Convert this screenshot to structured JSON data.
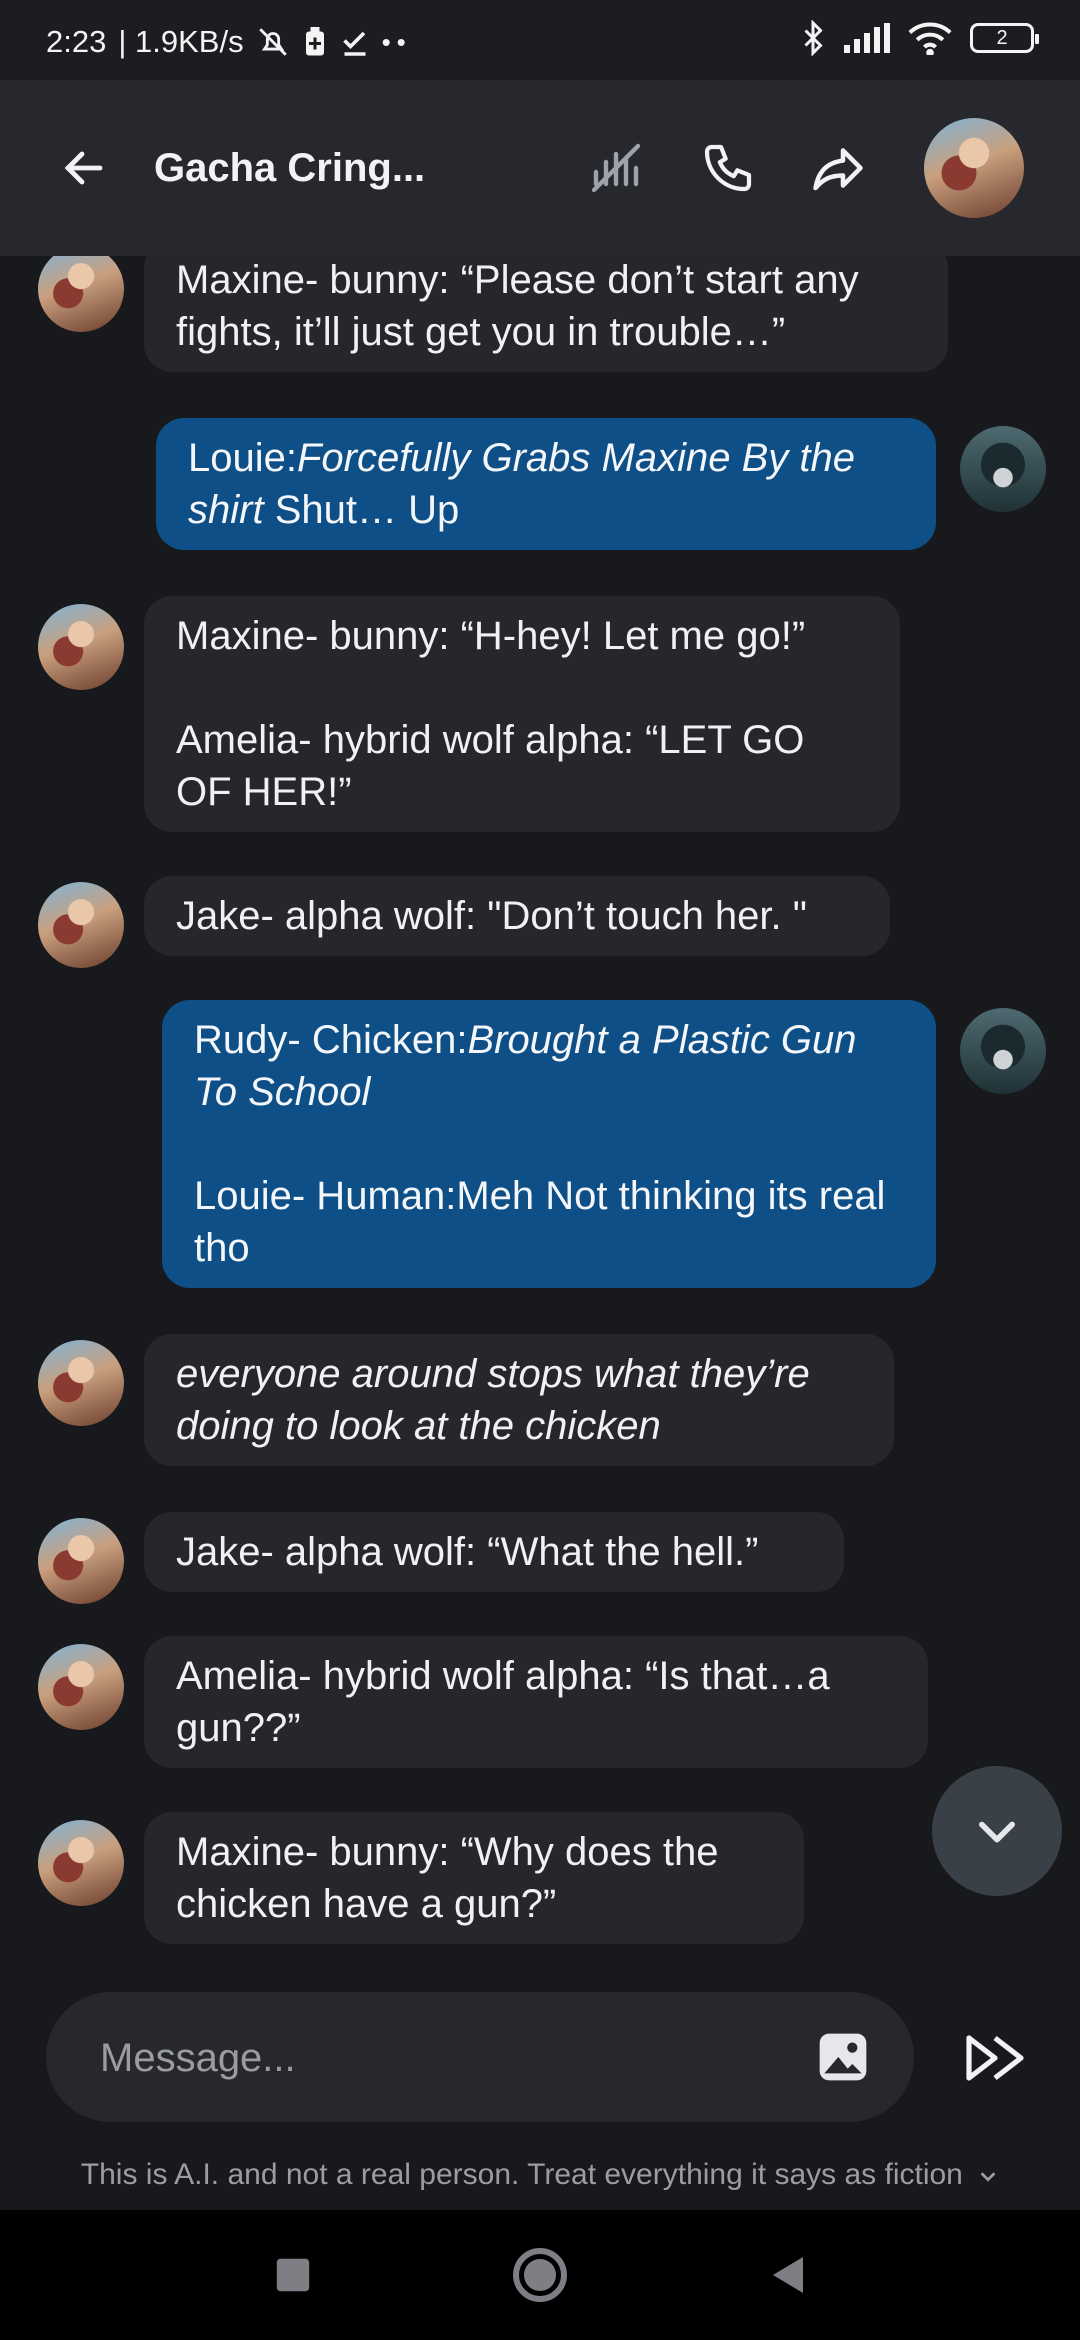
{
  "status_bar": {
    "time": "2:23",
    "speed": "| 1.9KB/s",
    "battery": "2"
  },
  "header": {
    "title": "Gacha Cring..."
  },
  "messages": [
    {
      "sender": "char",
      "parts": [
        {
          "text": "Maxine- bunny: “Please don’t start any fights, it’ll just get you in trouble…”"
        }
      ]
    },
    {
      "sender": "user",
      "parts": [
        {
          "text": "Louie:"
        },
        {
          "text": "Forcefully Grabs Maxine By the shirt",
          "italic": true
        },
        {
          "text": " Shut… Up"
        }
      ]
    },
    {
      "sender": "char",
      "parts": [
        {
          "text": "Maxine- bunny: “H-hey! Let me go!”"
        },
        {
          "break": true
        },
        {
          "text": "Amelia- hybrid wolf alpha: “LET GO OF HER!”"
        }
      ]
    },
    {
      "sender": "char",
      "parts": [
        {
          "text": "Jake- alpha wolf: \"Don’t touch her. \""
        }
      ]
    },
    {
      "sender": "user",
      "parts": [
        {
          "text": "Rudy- Chicken:"
        },
        {
          "text": "Brought a Plastic Gun To School",
          "italic": true
        },
        {
          "break": true
        },
        {
          "text": "Louie- Human:Meh Not thinking its real tho"
        }
      ]
    },
    {
      "sender": "char",
      "parts": [
        {
          "text": "everyone around stops what they’re doing to look at the chicken",
          "italic": true
        }
      ]
    },
    {
      "sender": "char",
      "parts": [
        {
          "text": "Jake- alpha wolf: “What the hell.”"
        }
      ]
    },
    {
      "sender": "char",
      "parts": [
        {
          "text": "Amelia- hybrid wolf alpha: “Is that…a gun??”"
        }
      ]
    },
    {
      "sender": "char",
      "parts": [
        {
          "text": "Maxine- bunny: “Why does the chicken have a gun?”"
        }
      ]
    }
  ],
  "input": {
    "placeholder": "Message..."
  },
  "disclaimer": "This is A.I. and not a real person. Treat everything it says as fiction",
  "colors": {
    "user_bubble": "#0d4f86",
    "char_bubble": "#26272c",
    "background": "#18191d"
  }
}
